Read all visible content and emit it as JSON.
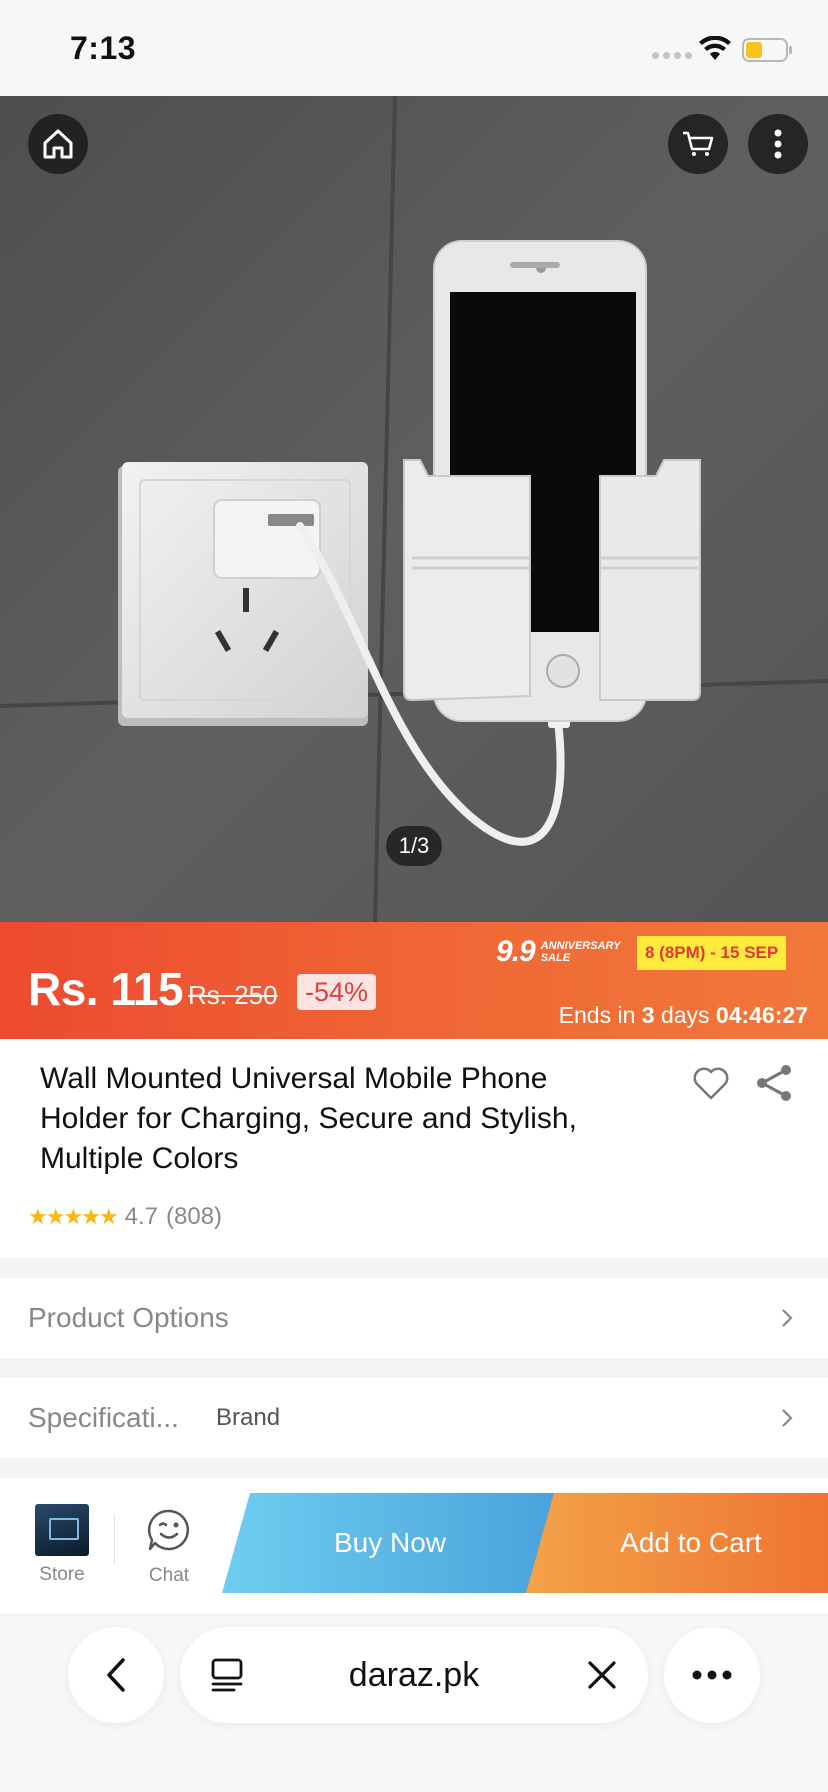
{
  "status_bar": {
    "time": "7:13"
  },
  "hero": {
    "pager": "1/3",
    "icons": [
      "home-icon",
      "cart-icon",
      "more-vertical-icon"
    ]
  },
  "price": {
    "current": "Rs. 115",
    "original": "Rs. 250",
    "discount": "-54%",
    "sale_big": "9.9",
    "sale_small": "ANNIVERSARY SALE",
    "sale_dates": "8 (8PM) - 15 SEP",
    "ends_prefix": "Ends in",
    "ends_days": "3",
    "ends_days_unit": "days",
    "ends_time": "04:46:27"
  },
  "product": {
    "title": "Wall Mounted Universal Mobile Phone Holder for Charging, Secure and Stylish, Multiple Colors",
    "rating": "4.7",
    "reviews": "(808)",
    "stars": "★★★★★"
  },
  "rows": {
    "options_label": "Product Options",
    "specs_label": "Specificati...",
    "specs_value": "Brand"
  },
  "actions": {
    "store_label": "Store",
    "chat_label": "Chat",
    "buy_now": "Buy Now",
    "add_to_cart": "Add to Cart"
  },
  "browser": {
    "url": "daraz.pk"
  },
  "colors": {
    "banner_start": "#ed4a2f",
    "banner_end": "#f2783a",
    "buy_now": "#4aa2dc",
    "add_to_cart": "#ef7430",
    "star": "#f8b713"
  }
}
